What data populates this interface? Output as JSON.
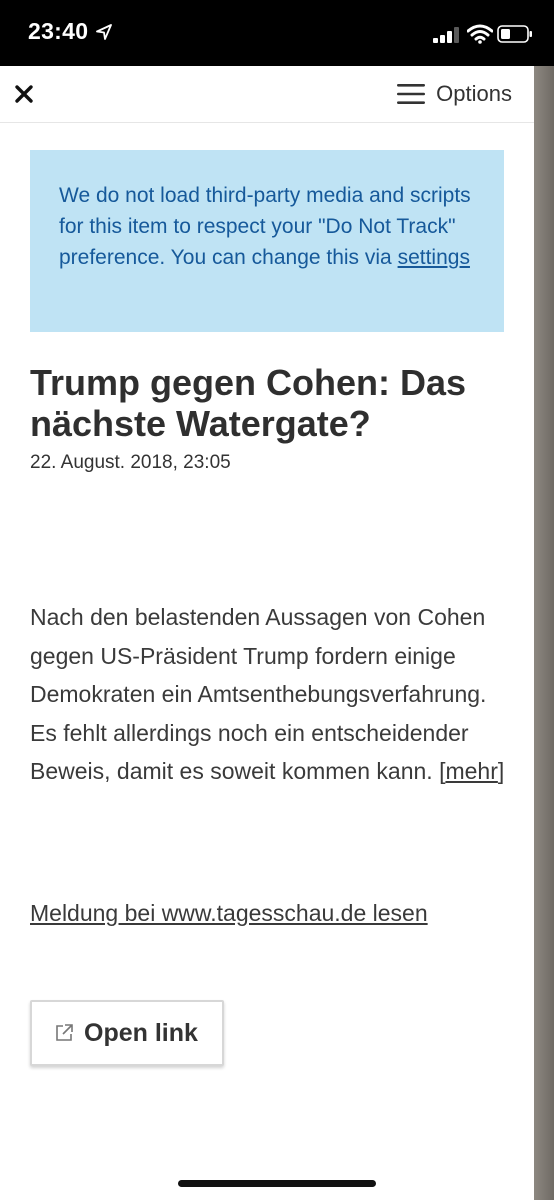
{
  "status_bar": {
    "time": "23:40",
    "icons": [
      "location-arrow-icon",
      "cellular-signal-icon",
      "wifi-icon",
      "battery-icon"
    ]
  },
  "toolbar": {
    "close_icon": "close-icon",
    "menu_icon": "hamburger-menu-icon",
    "options_label": "Options"
  },
  "notice": {
    "text": "We do not load third-party media and scripts for this item to respect your \"Do Not Track\" preference. You can change this via ",
    "link_label": "settings",
    "background": "#bfe3f4",
    "text_color": "#16599a"
  },
  "article": {
    "title": "Trump gegen Cohen: Das nächste Watergate?",
    "date": "22. August. 2018, 23:05",
    "body": "Nach den belastenden Aussagen von Cohen gegen US-Präsident Trump fordern einige Demokraten ein Amtsenthebungsverfahrung. Es fehlt allerdings noch ein entscheidender Beweis, damit es soweit kommen kann.",
    "more_label": "mehr",
    "source_link": "Meldung bei www.tagesschau.de lesen"
  },
  "actions": {
    "open_link_label": "Open link",
    "open_link_icon": "external-link-icon"
  }
}
